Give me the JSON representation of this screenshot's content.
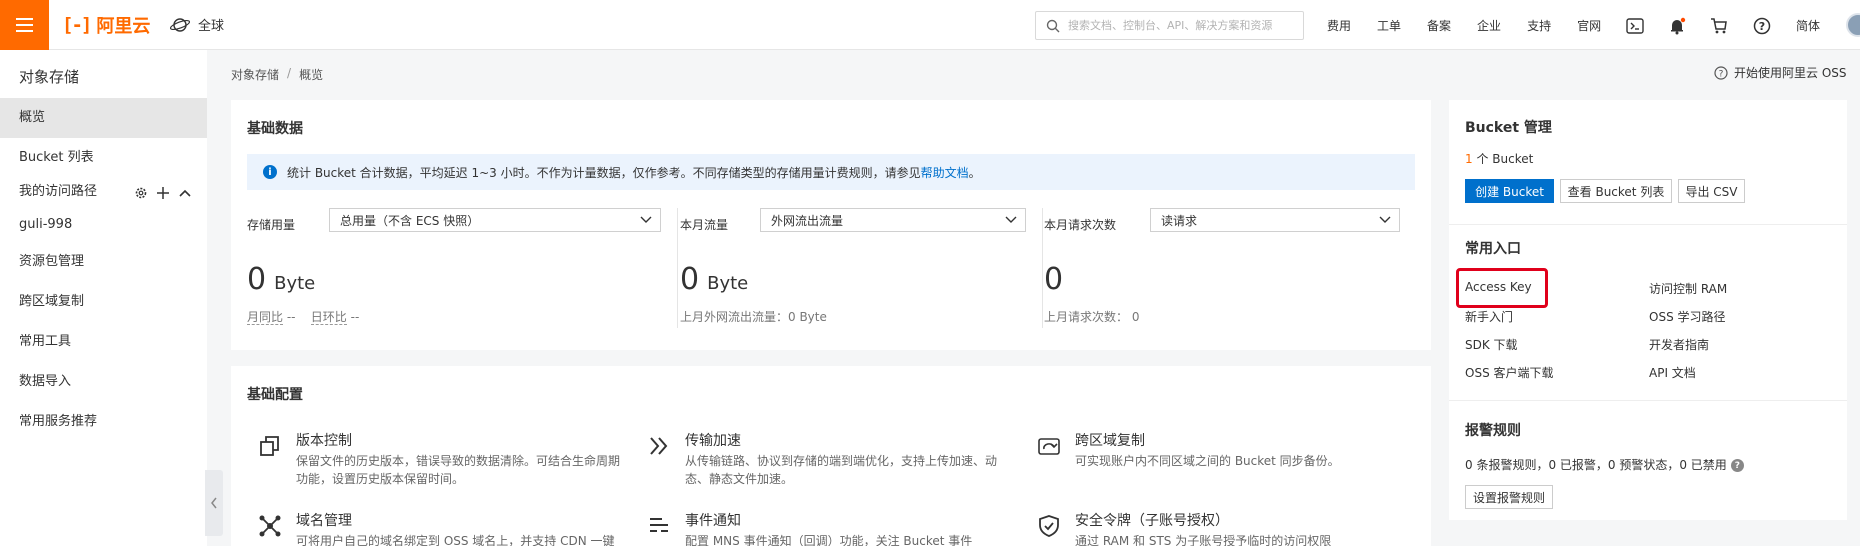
{
  "topbar": {
    "logo_text": "阿里云",
    "region": "全球",
    "search_placeholder": "搜索文档、控制台、API、解决方案和资源",
    "links": [
      "费用",
      "工单",
      "备案",
      "企业",
      "支持",
      "官网"
    ],
    "language": "简体"
  },
  "sidebar": {
    "title": "对象存储",
    "items": [
      {
        "label": "概览",
        "active": true
      },
      {
        "label": "Bucket 列表"
      },
      {
        "label": "我的访问路径"
      },
      {
        "label": "guli-998"
      },
      {
        "label": "资源包管理"
      },
      {
        "label": "跨区域复制"
      },
      {
        "label": "常用工具"
      },
      {
        "label": "数据导入"
      },
      {
        "label": "常用服务推荐"
      }
    ]
  },
  "breadcrumb": [
    "对象存储",
    "概览"
  ],
  "help_top": "开始使用阿里云 OSS",
  "basic_data": {
    "title": "基础数据",
    "notice": "统计 Bucket 合计数据，平均延迟 1~3 小时。不作为计量数据，仅作参考。不同存储类型的存储用量计费规则，请参见",
    "notice_link": "帮助文档",
    "notice_end": "。",
    "metrics": [
      {
        "label": "存储用量",
        "select": "总用量（不含 ECS 快照）",
        "value": "0",
        "unit": "Byte",
        "sub1": "月同比",
        "sub1_val": "--",
        "sub2": "日环比",
        "sub2_val": "--"
      },
      {
        "label": "本月流量",
        "select": "外网流出流量",
        "value": "0",
        "unit": "Byte",
        "sub": "上月外网流出流量：0 Byte"
      },
      {
        "label": "本月请求次数",
        "select": "读请求",
        "value": "0",
        "unit": "",
        "sub": "上月请求次数：  0"
      }
    ]
  },
  "basic_config": {
    "title": "基础配置",
    "features": [
      {
        "title": "版本控制",
        "desc": "保留文件的历史版本，错误导致的数据清除。可结合生命周期功能，设置历史版本保留时间。"
      },
      {
        "title": "传输加速",
        "desc": "从传输链路、协议到存储的端到端优化，支持上传加速、动态、静态文件加速。"
      },
      {
        "title": "跨区域复制",
        "desc": "可实现账户内不同区域之间的 Bucket 同步备份。"
      },
      {
        "title": "域名管理",
        "desc": "可将用户自己的域名绑定到 OSS 域名上，并支持 CDN 一键"
      },
      {
        "title": "事件通知",
        "desc": "配置 MNS 事件通知（回调）功能，关注 Bucket 事件"
      },
      {
        "title": "安全令牌（子账号授权）",
        "desc": "通过 RAM 和 STS 为子账号授予临时的访问权限"
      }
    ]
  },
  "bucket_mgmt": {
    "title": "Bucket 管理",
    "count": "1",
    "count_suffix": "个 Bucket",
    "create_btn": "创建 Bucket",
    "view_btn": "查看 Bucket 列表",
    "export_btn": "导出 CSV"
  },
  "common_entry": {
    "title": "常用入口",
    "links": [
      "Access Key",
      "访问控制 RAM",
      "新手入门",
      "OSS 学习路径",
      "SDK 下载",
      "开发者指南",
      "OSS 客户端下载",
      "API 文档"
    ]
  },
  "alarm": {
    "title": "报警规则",
    "summary": "0 条报警规则，0 已报警，0 预警状态，0 已禁用",
    "button": "设置报警规则"
  },
  "colors": {
    "brand": "#ff6a00",
    "primary": "#0070cc",
    "highlight": "#e0001b"
  }
}
